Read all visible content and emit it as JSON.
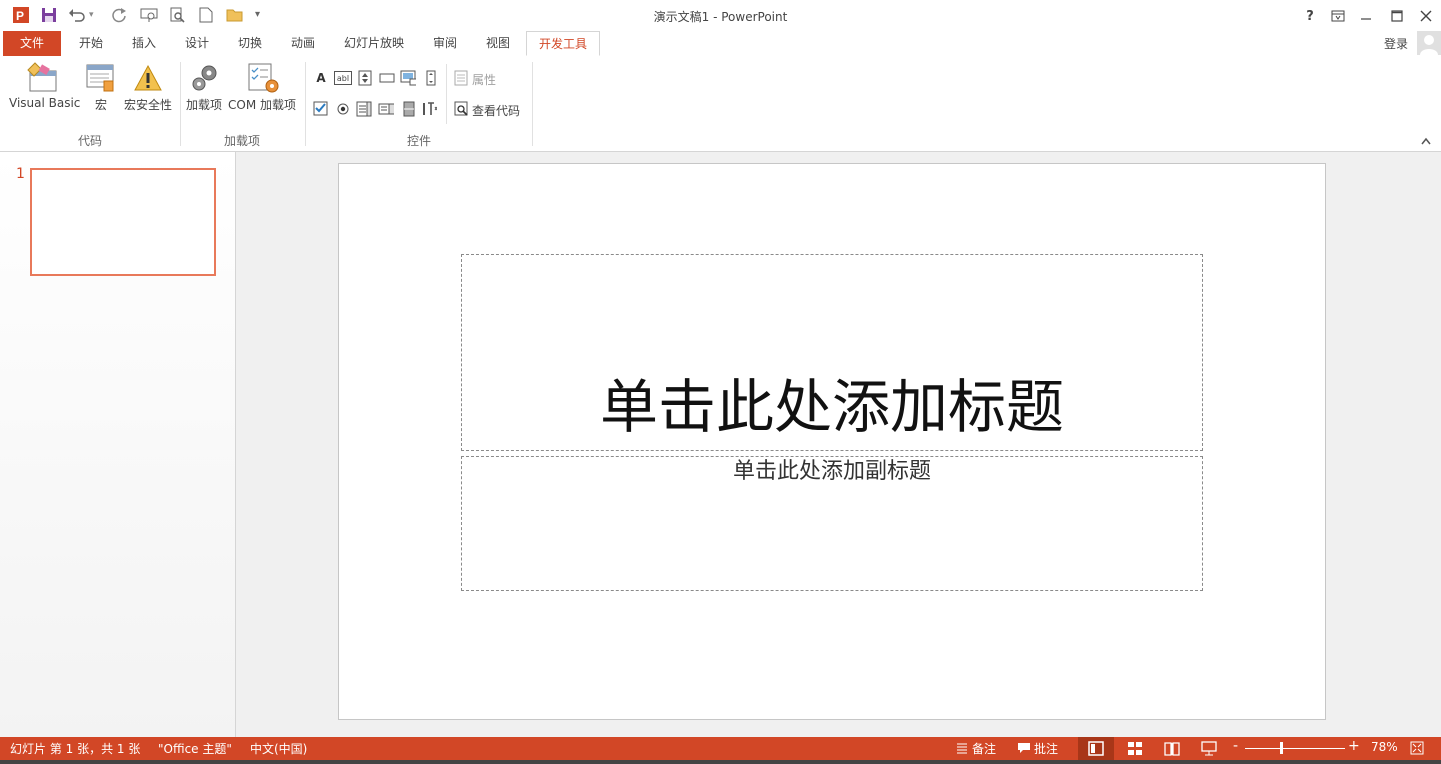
{
  "window": {
    "title": "演示文稿1 - PowerPoint",
    "help": "?",
    "sign_in": "登录"
  },
  "tabs": [
    "文件",
    "开始",
    "插入",
    "设计",
    "切换",
    "动画",
    "幻灯片放映",
    "审阅",
    "视图",
    "开发工具"
  ],
  "active_tab": "开发工具",
  "ribbon": {
    "groups": [
      {
        "label": "代码",
        "buttons": [
          "Visual Basic",
          "宏",
          "宏安全性"
        ]
      },
      {
        "label": "加载项",
        "buttons": [
          "加载项",
          "COM 加载项"
        ]
      },
      {
        "label": "控件",
        "buttons": [
          "属性",
          "查看代码"
        ]
      }
    ],
    "label_control_glyph": "A",
    "textbox_control_glyph": "abl"
  },
  "thumbnail": {
    "number": "1"
  },
  "slide": {
    "title_placeholder": "单击此处添加标题",
    "subtitle_placeholder": "单击此处添加副标题"
  },
  "status": {
    "slide_info": "幻灯片 第 1 张，共 1 张",
    "theme": "\"Office 主题\"",
    "language": "中文(中国)",
    "notes": "备注",
    "comments": "批注",
    "zoom_minus": "-",
    "zoom_plus": "+",
    "zoom": "78%"
  },
  "colors": {
    "accent": "#d24726",
    "thumb_border": "#e8795a"
  },
  "icons": [
    "powerpoint-logo-icon",
    "save-icon",
    "undo-icon",
    "redo-icon",
    "slideshow-from-start-icon",
    "print-preview-icon",
    "new-file-icon",
    "open-folder-icon",
    "customize-qat-icon",
    "help-icon",
    "ribbon-display-options-icon",
    "minimize-icon",
    "maximize-icon",
    "close-icon",
    "avatar-icon"
  ]
}
